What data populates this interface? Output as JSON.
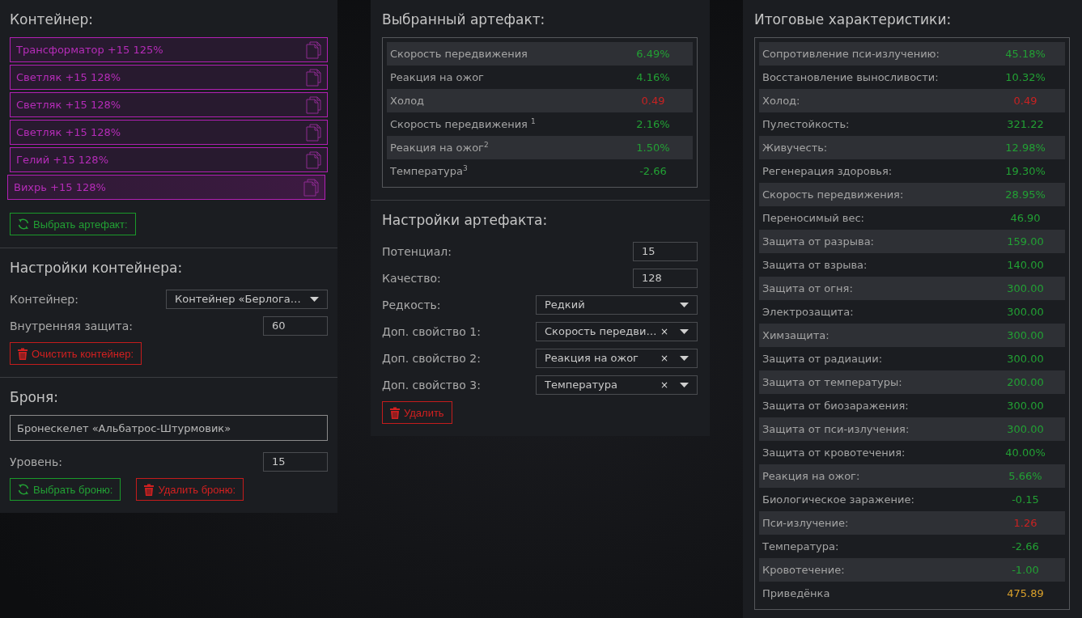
{
  "container": {
    "title": "Контейнер:",
    "artifacts": [
      {
        "label": "Трансформатор +15 125%",
        "selected": false
      },
      {
        "label": "Светляк +15 128%",
        "selected": false
      },
      {
        "label": "Светляк +15 128%",
        "selected": false
      },
      {
        "label": "Светляк +15 128%",
        "selected": false
      },
      {
        "label": "Гелий +15 128%",
        "selected": false
      },
      {
        "label": "Вихрь +15 128%",
        "selected": true
      }
    ],
    "select_button": "Выбрать артефакт:"
  },
  "container_settings": {
    "title": "Настройки контейнера:",
    "fields": [
      {
        "kind": "select",
        "label": "Контейнер:",
        "value": "Контейнер «Берлога…"
      },
      {
        "kind": "input",
        "label": "Внутренняя защита:",
        "value": "60"
      }
    ],
    "clear_button": "Очистить контейнер:"
  },
  "armor": {
    "title": "Броня:",
    "name": "Бронескелет «Альбатрос-Штурмовик»",
    "level_label": "Уровень:",
    "level_value": "15",
    "select_button": "Выбрать броню:",
    "delete_button": "Удалить броню:"
  },
  "selected_artifact": {
    "title": "Выбранный артефакт:",
    "stats": [
      {
        "name": "Скорость передвижения",
        "value": "6.49%",
        "color": "#22a034"
      },
      {
        "name": "Реакция на ожог",
        "value": "4.16%",
        "color": "#22a034"
      },
      {
        "name": "Холод",
        "value": "0.49",
        "color": "#c82222"
      },
      {
        "name": "Скорость передвижения $^{1}$",
        "value": "2.16%",
        "color": "#22a034"
      },
      {
        "name": "Реакция на ожог$^{2}$",
        "value": "1.50%",
        "color": "#22a034"
      },
      {
        "name": "Температура$^{3}$",
        "value": "-2.66",
        "color": "#22a034"
      }
    ]
  },
  "artifact_settings": {
    "title": "Настройки артефакта:",
    "fields": [
      {
        "kind": "input",
        "label": "Потенциал:",
        "value": "15"
      },
      {
        "kind": "input",
        "label": "Качество:",
        "value": "128"
      },
      {
        "kind": "select",
        "label": "Редкость:",
        "value": "Редкий"
      },
      {
        "kind": "clearable",
        "label": "Доп. свойство 1:",
        "value": "Скорость передви…",
        "clear": "×"
      },
      {
        "kind": "clearable",
        "label": "Доп. свойство 2:",
        "value": "Реакция на ожог",
        "clear": "×"
      },
      {
        "kind": "clearable",
        "label": "Доп. свойство 3:",
        "value": "Температура",
        "clear": "×"
      }
    ],
    "delete_button": "Удалить"
  },
  "totals": {
    "title": "Итоговые характеристики:",
    "stats": [
      {
        "name": "Сопротивление пси-излучению:",
        "value": "45.18%",
        "color": "#22a034"
      },
      {
        "name": "Восстановление выносливости:",
        "value": "10.32%",
        "color": "#22a034"
      },
      {
        "name": "Холод:",
        "value": "0.49",
        "color": "#c82222"
      },
      {
        "name": "Пулестойкость:",
        "value": "321.22",
        "color": "#22a034"
      },
      {
        "name": "Живучесть:",
        "value": "12.98%",
        "color": "#22a034"
      },
      {
        "name": "Регенерация здоровья:",
        "value": "19.30%",
        "color": "#22a034"
      },
      {
        "name": "Скорость передвижения:",
        "value": "28.95%",
        "color": "#22a034"
      },
      {
        "name": "Переносимый вес:",
        "value": "46.90",
        "color": "#22a034"
      },
      {
        "name": "Защита от разрыва:",
        "value": "159.00",
        "color": "#22a034"
      },
      {
        "name": "Защита от взрыва:",
        "value": "140.00",
        "color": "#22a034"
      },
      {
        "name": "Защита от огня:",
        "value": "300.00",
        "color": "#22a034"
      },
      {
        "name": "Электрозащита:",
        "value": "300.00",
        "color": "#22a034"
      },
      {
        "name": "Химзащита:",
        "value": "300.00",
        "color": "#22a034"
      },
      {
        "name": "Защита от радиации:",
        "value": "300.00",
        "color": "#22a034"
      },
      {
        "name": "Защита от температуры:",
        "value": "200.00",
        "color": "#22a034"
      },
      {
        "name": "Защита от биозаражения:",
        "value": "300.00",
        "color": "#22a034"
      },
      {
        "name": "Защита от пси-излучения:",
        "value": "300.00",
        "color": "#22a034"
      },
      {
        "name": "Защита от кровотечения:",
        "value": "40.00%",
        "color": "#22a034"
      },
      {
        "name": "Реакция на ожог:",
        "value": "5.66%",
        "color": "#22a034"
      },
      {
        "name": "Биологическое заражение:",
        "value": "-0.15",
        "color": "#22a034"
      },
      {
        "name": "Пси-излучение:",
        "value": "1.26",
        "color": "#c82222"
      },
      {
        "name": "Температура:",
        "value": "-2.66",
        "color": "#22a034"
      },
      {
        "name": "Кровотечение:",
        "value": "-1.00",
        "color": "#22a034"
      },
      {
        "name": "Приведёнка",
        "value": "475.89",
        "color": "#d9a02b"
      }
    ]
  }
}
